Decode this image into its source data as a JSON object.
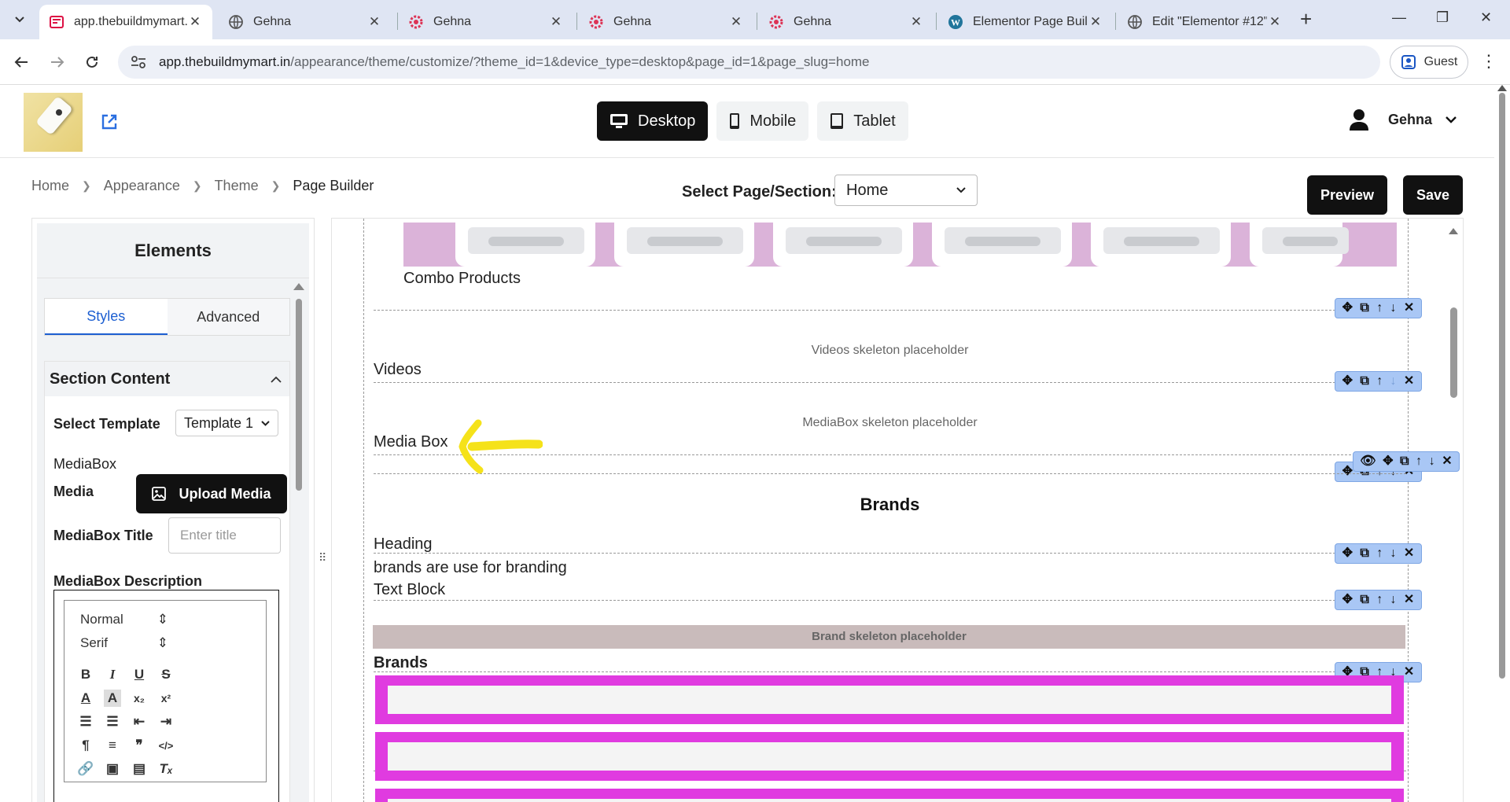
{
  "browser": {
    "tabs": [
      {
        "title": "app.thebuildmymart.in",
        "active": true
      },
      {
        "title": "Gehna"
      },
      {
        "title": "Gehna"
      },
      {
        "title": "Gehna"
      },
      {
        "title": "Gehna"
      },
      {
        "title": "Elementor Page Builder"
      },
      {
        "title": "Edit \"Elementor #12\""
      }
    ],
    "url_host": "app.thebuildmymart.in",
    "url_path": "/appearance/theme/customize/?theme_id=1&device_type=desktop&page_id=1&page_slug=home",
    "profile_label": "Guest"
  },
  "header": {
    "devices": [
      {
        "label": "Desktop",
        "active": true
      },
      {
        "label": "Mobile"
      },
      {
        "label": "Tablet"
      }
    ],
    "user_name": "Gehna"
  },
  "breadcrumb": [
    "Home",
    "Appearance",
    "Theme",
    "Page Builder"
  ],
  "page_select": {
    "label": "Select Page/Section:",
    "value": "Home"
  },
  "actions": {
    "preview": "Preview",
    "save": "Save"
  },
  "left_panel": {
    "title": "Elements",
    "tabs": [
      "Styles",
      "Advanced"
    ],
    "section_title": "Section Content",
    "template_label": "Select Template",
    "template_value": "Template 1",
    "mediabox_label": "MediaBox",
    "media_label": "Media",
    "upload_label": "Upload Media",
    "title_label": "MediaBox Title",
    "title_placeholder": "Enter title",
    "description_label": "MediaBox Description",
    "editor": {
      "format": "Normal",
      "font": "Serif"
    }
  },
  "canvas": {
    "combo_label": "Combo Products",
    "videos_placeholder": "Videos skeleton placeholder",
    "videos_label": "Videos",
    "mediabox_placeholder": "MediaBox skeleton placeholder",
    "mediabox_label": "Media Box",
    "brands_heading": "Brands",
    "heading_label": "Heading",
    "text_value": "brands are use for branding",
    "text_block_label": "Text Block",
    "brand_placeholder": "Brand skeleton placeholder",
    "brands_label": "Brands"
  },
  "colors": {
    "accent": "#1d5fd1",
    "toolbar_blue": "#a9c7f5",
    "combo_bg": "#dbb3d9",
    "brand_pink": "#e03be0",
    "annotation_yellow": "#f5e21a"
  }
}
